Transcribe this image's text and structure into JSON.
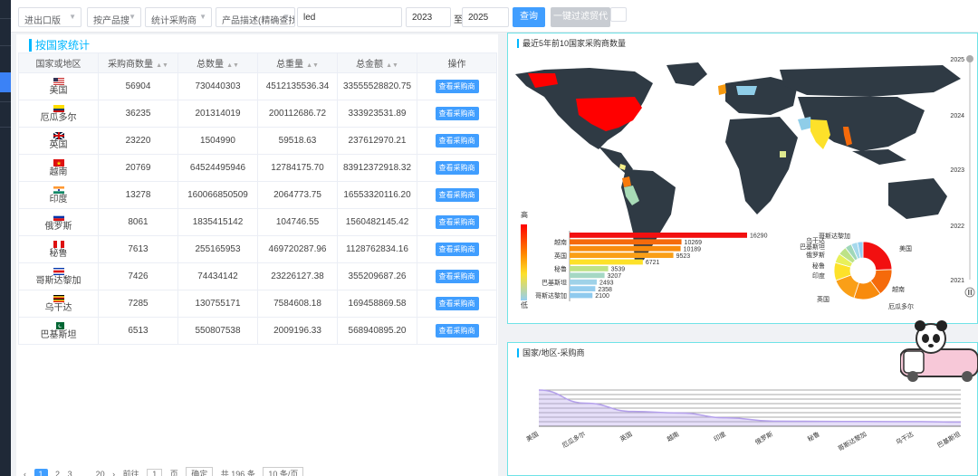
{
  "filters": {
    "port": "进出口版",
    "product_dim": "按产品搜",
    "stat_mode": "统计采购商",
    "desc_mode": "产品描述(精确查找)",
    "keyword": "led",
    "year_from": "2023",
    "to": "至",
    "year_to": "2025",
    "query": "查询",
    "one_click": "一键过滤贸代"
  },
  "left_panel": {
    "title": "按国家统计",
    "columns": [
      "国家或地区",
      "采购商数量",
      "总数量",
      "总重量",
      "总金额",
      "操作"
    ],
    "action_label": "查看采购商",
    "rows": [
      {
        "country": "美国",
        "buyers": "56904",
        "qty": "730440303",
        "weight": "4512135536.34",
        "amount": "33555528820.75",
        "flag": "us"
      },
      {
        "country": "厄瓜多尔",
        "buyers": "36235",
        "qty": "201314019",
        "weight": "200112686.72",
        "amount": "333923531.89",
        "flag": "ec"
      },
      {
        "country": "英国",
        "buyers": "23220",
        "qty": "1504990",
        "weight": "59518.63",
        "amount": "237612970.21",
        "flag": "gb"
      },
      {
        "country": "越南",
        "buyers": "20769",
        "qty": "64524495946",
        "weight": "12784175.70",
        "amount": "83912372918.32",
        "flag": "vn"
      },
      {
        "country": "印度",
        "buyers": "13278",
        "qty": "160066850509",
        "weight": "2064773.75",
        "amount": "16553320116.20",
        "flag": "in"
      },
      {
        "country": "俄罗斯",
        "buyers": "8061",
        "qty": "1835415142",
        "weight": "104746.55",
        "amount": "1560482145.42",
        "flag": "ru"
      },
      {
        "country": "秘鲁",
        "buyers": "7613",
        "qty": "255165953",
        "weight": "469720287.96",
        "amount": "1128762834.16",
        "flag": "pe"
      },
      {
        "country": "哥斯达黎加",
        "buyers": "7426",
        "qty": "74434142",
        "weight": "23226127.38",
        "amount": "355209687.26",
        "flag": "cr"
      },
      {
        "country": "乌干达",
        "buyers": "7285",
        "qty": "130755171",
        "weight": "7584608.18",
        "amount": "169458869.58",
        "flag": "ug"
      },
      {
        "country": "巴基斯坦",
        "buyers": "6513",
        "qty": "550807538",
        "weight": "2009196.33",
        "amount": "568940895.20",
        "flag": "pk"
      }
    ],
    "pager": {
      "prev": "‹",
      "pages": [
        "1",
        "2",
        "3"
      ],
      "ellipsis": "…",
      "last": "20",
      "next": "›",
      "goto": "前往",
      "goto_value": "1",
      "page_unit": "页",
      "confirm": "确定",
      "total": "共 196 条",
      "per_page": "10 条/页"
    }
  },
  "map_panel": {
    "title": "最近5年前10国家采购商数量",
    "legend_high": "高",
    "legend_low": "低",
    "years": [
      "2025",
      "2024",
      "2023",
      "2022",
      "2021"
    ],
    "pause_icon": "pause-icon"
  },
  "line_panel": {
    "title": "国家/地区-采购商"
  },
  "chart_data": [
    {
      "type": "bar",
      "orientation": "horizontal",
      "categories": [
        "",
        "越南",
        "",
        "英国",
        "",
        "秘鲁",
        "",
        "巴基斯坦",
        "",
        "哥斯达黎加"
      ],
      "values": [
        16290,
        10269,
        10189,
        9523,
        6721,
        3539,
        3207,
        2493,
        2358,
        2100
      ]
    },
    {
      "type": "pie",
      "donut": true,
      "labels": [
        "美国",
        "越南",
        "厄瓜多尔",
        "英国",
        "印度",
        "秘鲁",
        "俄罗斯",
        "巴基斯坦",
        "乌干达",
        "哥斯达黎加"
      ],
      "values": [
        16290,
        10269,
        10189,
        9523,
        6721,
        3539,
        3207,
        2493,
        2358,
        2100
      ],
      "colors": [
        "#f21010",
        "#f56a0b",
        "#f88b0d",
        "#fa9f17",
        "#fde12a",
        "#e8f05a",
        "#bde287",
        "#9fd7b9",
        "#a6d9ec",
        "#94cff0"
      ]
    },
    {
      "type": "area",
      "categories": [
        "美国",
        "厄瓜多尔",
        "英国",
        "越南",
        "印度",
        "俄罗斯",
        "秘鲁",
        "哥斯达黎加",
        "乌干达",
        "巴基斯坦"
      ],
      "values": [
        56904,
        36235,
        23220,
        20769,
        13278,
        8061,
        7613,
        7426,
        7285,
        6513
      ],
      "grid": true
    }
  ],
  "colors": {
    "primary": "#409eff",
    "accent": "#00b7ff",
    "panel_border": "#6fe3e7",
    "map_land": "#2f3a44",
    "top_country": "#ff0000"
  }
}
